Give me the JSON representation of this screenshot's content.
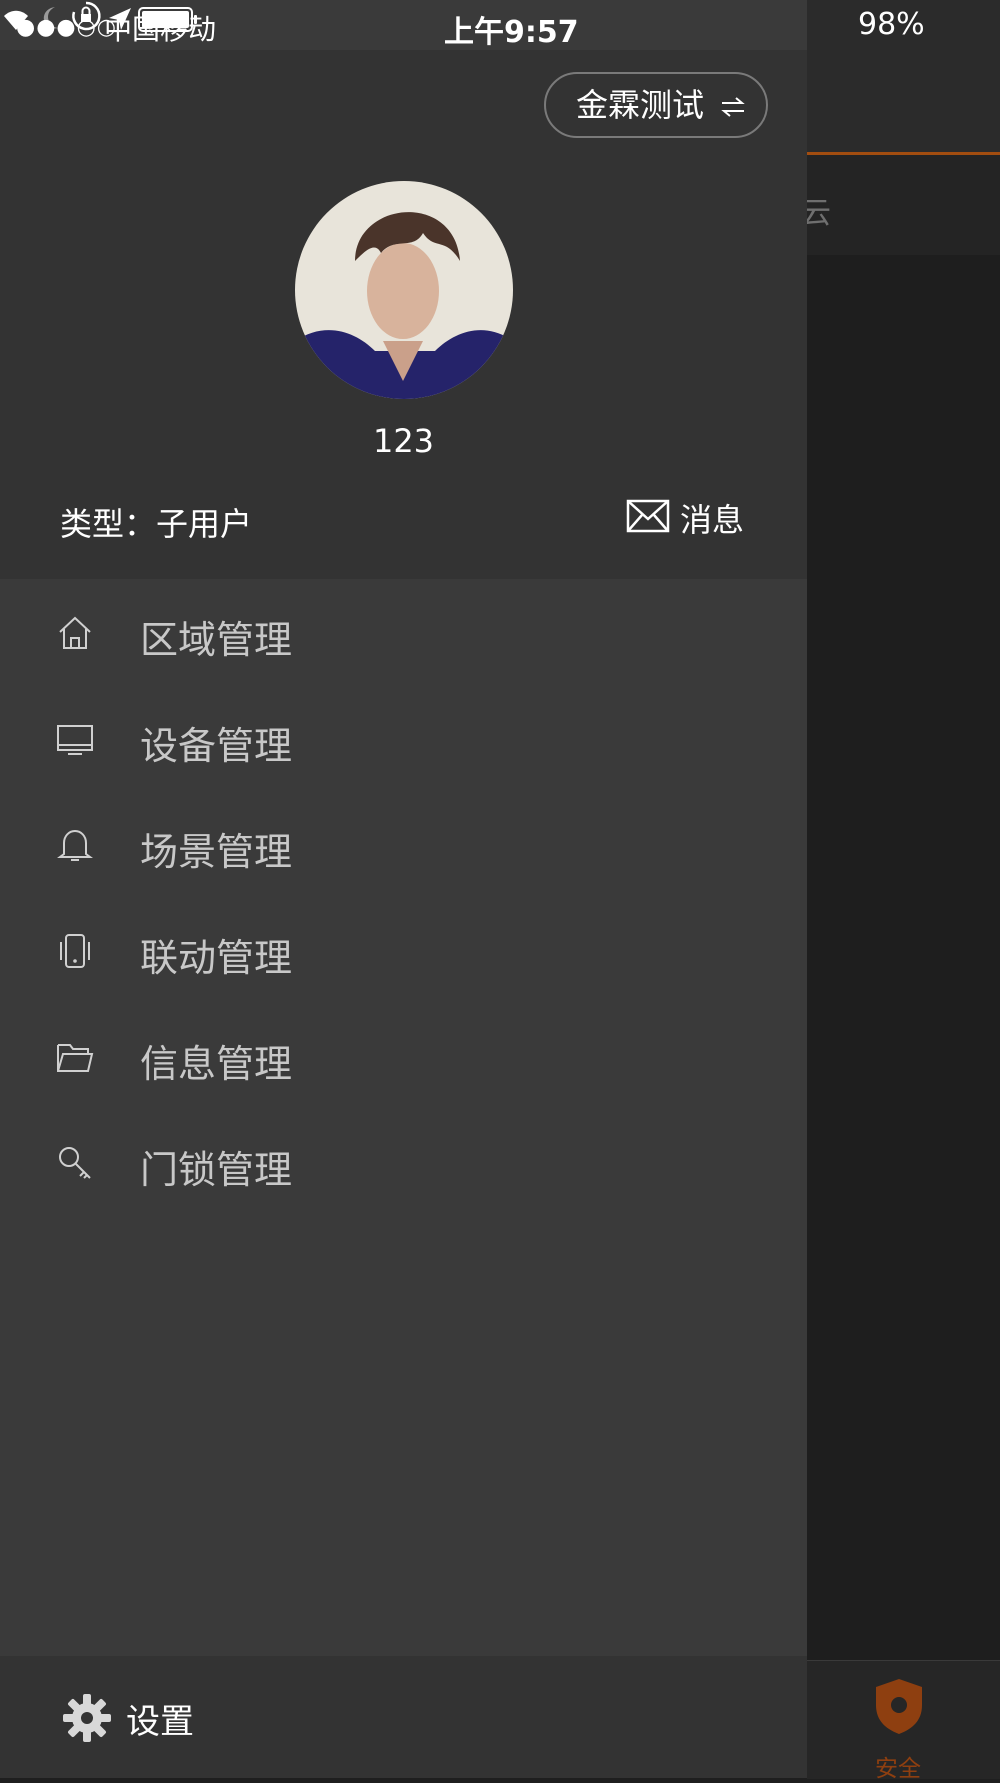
{
  "status_bar": {
    "signal_dots": "●●●○○",
    "carrier": "中国移动",
    "time": "上午9:57",
    "battery": "98%"
  },
  "drawer": {
    "site_switch_label": "金霖测试",
    "username": "123",
    "user_type": "类型：子用户",
    "messages_label": "消息",
    "menu": [
      {
        "label": "区域管理",
        "icon": "home-icon"
      },
      {
        "label": "设备管理",
        "icon": "monitor-icon"
      },
      {
        "label": "场景管理",
        "icon": "bell-icon"
      },
      {
        "label": "联动管理",
        "icon": "phone-vibrate-icon"
      },
      {
        "label": "信息管理",
        "icon": "folder-icon"
      },
      {
        "label": "门锁管理",
        "icon": "key-icon"
      }
    ],
    "settings_label": "设置"
  },
  "background": {
    "partial_text": "云",
    "tab_security_label": "安全"
  },
  "colors": {
    "accent": "#a24d10",
    "drawer_bg": "#3a3a3a",
    "drawer_header_bg": "#333333"
  }
}
